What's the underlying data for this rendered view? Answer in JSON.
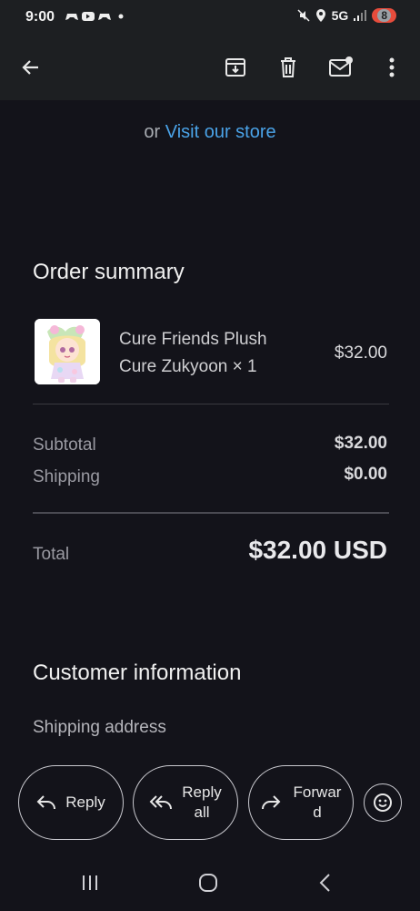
{
  "status": {
    "time": "9:00",
    "left_icons": [
      "game-controller-icon",
      "youtube-icon",
      "game-controller-icon",
      "dot-icon"
    ],
    "network": "5G",
    "battery": "8"
  },
  "toolbar": {
    "back": "back-arrow-icon",
    "archive": "archive-icon",
    "delete": "trash-icon",
    "mark_unread": "mail-unread-icon",
    "more": "more-vert-icon"
  },
  "store_link": {
    "prefix": "or",
    "link": "Visit our store"
  },
  "order_summary": {
    "title": "Order summary",
    "item": {
      "name_line1": "Cure Friends Plush",
      "name_line2": "Cure Zukyoon × 1",
      "price": "$32.00"
    },
    "subtotal": {
      "label": "Subtotal",
      "value": "$32.00"
    },
    "shipping": {
      "label": "Shipping",
      "value": "$0.00"
    },
    "total": {
      "label": "Total",
      "value": "$32.00 USD"
    }
  },
  "customer_info": {
    "title": "Customer information",
    "shipping_address_label": "Shipping address"
  },
  "actions": {
    "reply": "Reply",
    "reply_all_line1": "Reply",
    "reply_all_line2": "all",
    "forward_line1": "Forwar",
    "forward_line2": "d"
  },
  "colors": {
    "background": "#13131a",
    "link": "#4aa3e8",
    "appbar": "#1d1f22"
  }
}
